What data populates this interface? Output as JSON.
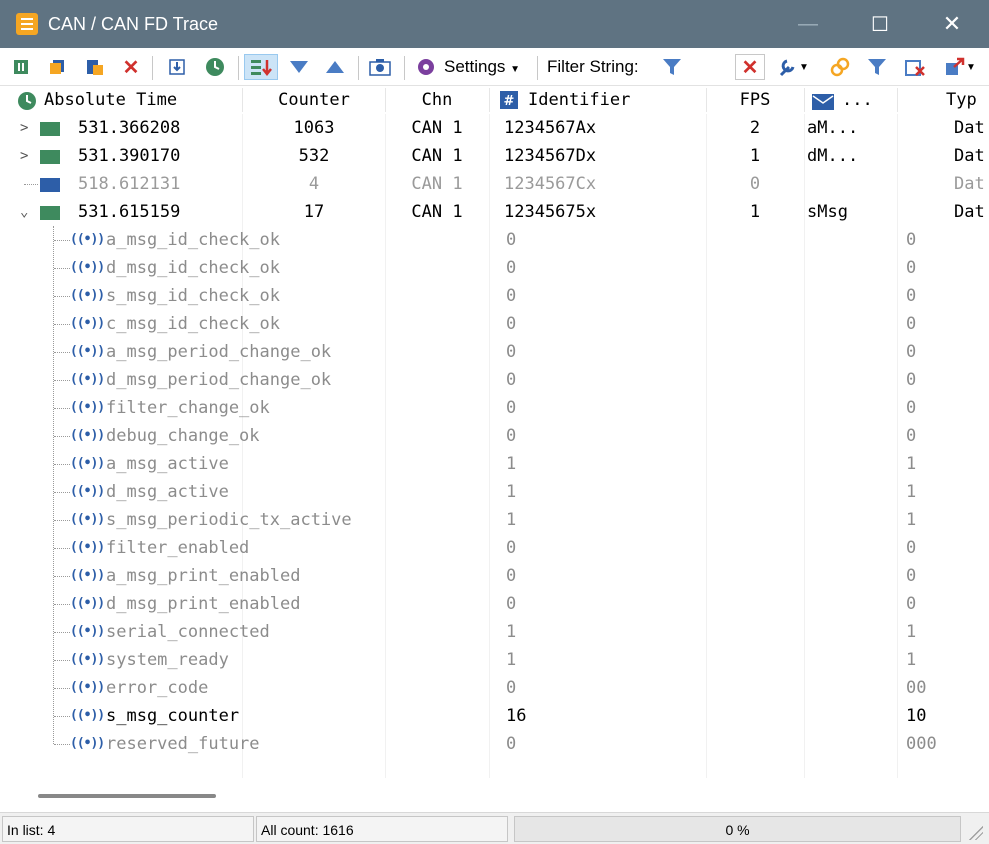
{
  "window": {
    "title": "CAN / CAN FD Trace",
    "title_bar_color": "#5f7382",
    "controls": {
      "minimize": "—",
      "maximize": "☐",
      "close": "✕"
    }
  },
  "toolbar": {
    "settings_label": "Settings",
    "filter_label": "Filter String:",
    "icons": [
      "pause-icon",
      "copy-icon",
      "clipboard-icon",
      "delete-icon",
      "save-trace-icon",
      "clock-icon",
      "sort-icon",
      "filter-down-icon",
      "filter-up-icon",
      "camera-icon",
      "gear-icon",
      "funnel-icon",
      "clear-filter-icon",
      "wrench-icon",
      "link-icon",
      "funnel-icon",
      "filter-remove-icon",
      "export-icon"
    ]
  },
  "columns": {
    "time": "Absolute Time",
    "counter": "Counter",
    "chn": "Chn",
    "identifier": "Identifier",
    "fps": "FPS",
    "name": "...",
    "type": "Typ"
  },
  "messages": [
    {
      "expander": ">",
      "time": "531.366208",
      "counter": "1063",
      "chn": "CAN 1",
      "identifier": "1234567Ax",
      "fps": "2",
      "name": "aM...",
      "type": "Dat",
      "icon_color": "green",
      "dim": false
    },
    {
      "expander": ">",
      "time": "531.390170",
      "counter": "532",
      "chn": "CAN 1",
      "identifier": "1234567Dx",
      "fps": "1",
      "name": "dM...",
      "type": "Dat",
      "icon_color": "green",
      "dim": false
    },
    {
      "expander": "",
      "time": "518.612131",
      "counter": "4",
      "chn": "CAN 1",
      "identifier": "1234567Cx",
      "fps": "0",
      "name": "",
      "type": "Dat",
      "icon_color": "blue",
      "dim": true
    },
    {
      "expander": "⌄",
      "time": "531.615159",
      "counter": "17",
      "chn": "CAN 1",
      "identifier": "12345675x",
      "fps": "1",
      "name": "sMsg",
      "type": "Dat",
      "icon_color": "green",
      "dim": false
    }
  ],
  "signals": [
    {
      "name": "a_msg_id_check_ok",
      "value": "0",
      "raw": "0",
      "highlight": false
    },
    {
      "name": "d_msg_id_check_ok",
      "value": "0",
      "raw": "0",
      "highlight": false
    },
    {
      "name": "s_msg_id_check_ok",
      "value": "0",
      "raw": "0",
      "highlight": false
    },
    {
      "name": "c_msg_id_check_ok",
      "value": "0",
      "raw": "0",
      "highlight": false
    },
    {
      "name": "a_msg_period_change_ok",
      "value": "0",
      "raw": "0",
      "highlight": false
    },
    {
      "name": "d_msg_period_change_ok",
      "value": "0",
      "raw": "0",
      "highlight": false
    },
    {
      "name": "filter_change_ok",
      "value": "0",
      "raw": "0",
      "highlight": false
    },
    {
      "name": "debug_change_ok",
      "value": "0",
      "raw": "0",
      "highlight": false
    },
    {
      "name": "a_msg_active",
      "value": "1",
      "raw": "1",
      "highlight": false
    },
    {
      "name": "d_msg_active",
      "value": "1",
      "raw": "1",
      "highlight": false
    },
    {
      "name": "s_msg_periodic_tx_active",
      "value": "1",
      "raw": "1",
      "highlight": false
    },
    {
      "name": "filter_enabled",
      "value": "0",
      "raw": "0",
      "highlight": false
    },
    {
      "name": "a_msg_print_enabled",
      "value": "0",
      "raw": "0",
      "highlight": false
    },
    {
      "name": "d_msg_print_enabled",
      "value": "0",
      "raw": "0",
      "highlight": false
    },
    {
      "name": "serial_connected",
      "value": "1",
      "raw": "1",
      "highlight": false
    },
    {
      "name": "system_ready",
      "value": "1",
      "raw": "1",
      "highlight": false
    },
    {
      "name": "error_code",
      "value": "0",
      "raw": "00",
      "highlight": false
    },
    {
      "name": "s_msg_counter",
      "value": "16",
      "raw": "10",
      "highlight": true
    },
    {
      "name": "reserved_future",
      "value": "0",
      "raw": "000",
      "highlight": false
    }
  ],
  "status": {
    "in_list": "In list: 4",
    "all_count": "All count: 1616",
    "progress": "0 %",
    "progress_value": 0
  }
}
